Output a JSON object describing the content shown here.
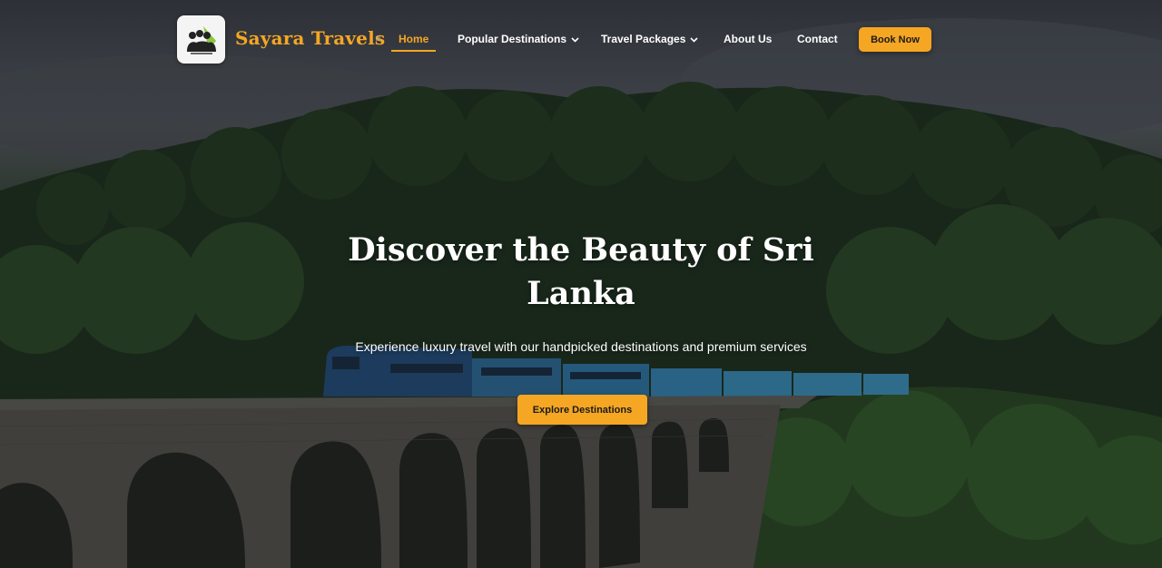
{
  "brand": {
    "name": "Sayara Travels",
    "logo_icon": "sayara-logo-icon"
  },
  "nav": {
    "close_symbol": "×",
    "items": [
      {
        "label": "Home",
        "active": true
      },
      {
        "label": "Popular Destinations",
        "has_dropdown": true
      },
      {
        "label": "Travel Packages",
        "has_dropdown": true
      },
      {
        "label": "About Us"
      },
      {
        "label": "Contact"
      }
    ],
    "cta_label": "Book Now"
  },
  "hero": {
    "headline": "Discover the Beauty of Sri Lanka",
    "subheadline": "Experience luxury travel with our handpicked destinations and premium services",
    "cta_label": "Explore Destinations",
    "background_description": "hero-background-image"
  },
  "colors": {
    "accent": "#f5a623",
    "text": "#ffffff"
  }
}
